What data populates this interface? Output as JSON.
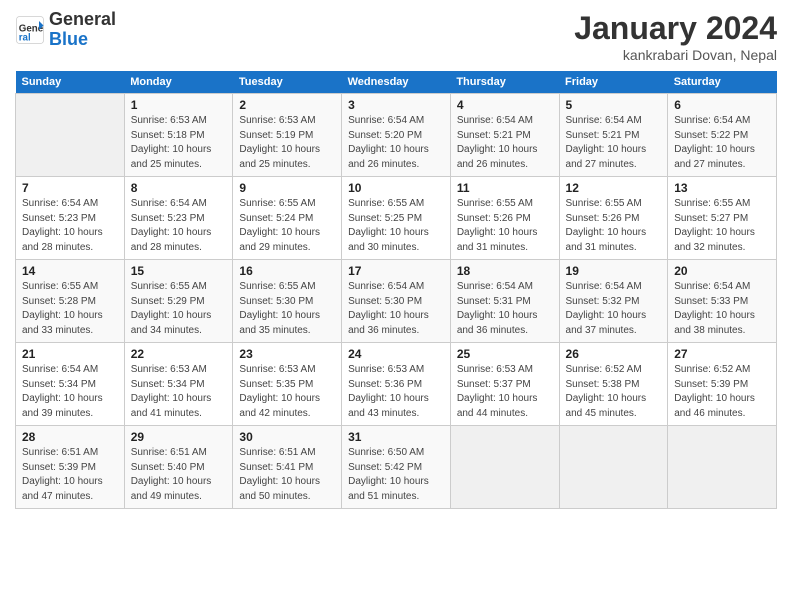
{
  "header": {
    "logo_line1": "General",
    "logo_line2": "Blue",
    "month": "January 2024",
    "location": "kankrabari Dovan, Nepal"
  },
  "weekdays": [
    "Sunday",
    "Monday",
    "Tuesday",
    "Wednesday",
    "Thursday",
    "Friday",
    "Saturday"
  ],
  "weeks": [
    [
      {
        "num": "",
        "info": ""
      },
      {
        "num": "1",
        "info": "Sunrise: 6:53 AM\nSunset: 5:18 PM\nDaylight: 10 hours\nand 25 minutes."
      },
      {
        "num": "2",
        "info": "Sunrise: 6:53 AM\nSunset: 5:19 PM\nDaylight: 10 hours\nand 25 minutes."
      },
      {
        "num": "3",
        "info": "Sunrise: 6:54 AM\nSunset: 5:20 PM\nDaylight: 10 hours\nand 26 minutes."
      },
      {
        "num": "4",
        "info": "Sunrise: 6:54 AM\nSunset: 5:21 PM\nDaylight: 10 hours\nand 26 minutes."
      },
      {
        "num": "5",
        "info": "Sunrise: 6:54 AM\nSunset: 5:21 PM\nDaylight: 10 hours\nand 27 minutes."
      },
      {
        "num": "6",
        "info": "Sunrise: 6:54 AM\nSunset: 5:22 PM\nDaylight: 10 hours\nand 27 minutes."
      }
    ],
    [
      {
        "num": "7",
        "info": "Sunrise: 6:54 AM\nSunset: 5:23 PM\nDaylight: 10 hours\nand 28 minutes."
      },
      {
        "num": "8",
        "info": "Sunrise: 6:54 AM\nSunset: 5:23 PM\nDaylight: 10 hours\nand 28 minutes."
      },
      {
        "num": "9",
        "info": "Sunrise: 6:55 AM\nSunset: 5:24 PM\nDaylight: 10 hours\nand 29 minutes."
      },
      {
        "num": "10",
        "info": "Sunrise: 6:55 AM\nSunset: 5:25 PM\nDaylight: 10 hours\nand 30 minutes."
      },
      {
        "num": "11",
        "info": "Sunrise: 6:55 AM\nSunset: 5:26 PM\nDaylight: 10 hours\nand 31 minutes."
      },
      {
        "num": "12",
        "info": "Sunrise: 6:55 AM\nSunset: 5:26 PM\nDaylight: 10 hours\nand 31 minutes."
      },
      {
        "num": "13",
        "info": "Sunrise: 6:55 AM\nSunset: 5:27 PM\nDaylight: 10 hours\nand 32 minutes."
      }
    ],
    [
      {
        "num": "14",
        "info": "Sunrise: 6:55 AM\nSunset: 5:28 PM\nDaylight: 10 hours\nand 33 minutes."
      },
      {
        "num": "15",
        "info": "Sunrise: 6:55 AM\nSunset: 5:29 PM\nDaylight: 10 hours\nand 34 minutes."
      },
      {
        "num": "16",
        "info": "Sunrise: 6:55 AM\nSunset: 5:30 PM\nDaylight: 10 hours\nand 35 minutes."
      },
      {
        "num": "17",
        "info": "Sunrise: 6:54 AM\nSunset: 5:30 PM\nDaylight: 10 hours\nand 36 minutes."
      },
      {
        "num": "18",
        "info": "Sunrise: 6:54 AM\nSunset: 5:31 PM\nDaylight: 10 hours\nand 36 minutes."
      },
      {
        "num": "19",
        "info": "Sunrise: 6:54 AM\nSunset: 5:32 PM\nDaylight: 10 hours\nand 37 minutes."
      },
      {
        "num": "20",
        "info": "Sunrise: 6:54 AM\nSunset: 5:33 PM\nDaylight: 10 hours\nand 38 minutes."
      }
    ],
    [
      {
        "num": "21",
        "info": "Sunrise: 6:54 AM\nSunset: 5:34 PM\nDaylight: 10 hours\nand 39 minutes."
      },
      {
        "num": "22",
        "info": "Sunrise: 6:53 AM\nSunset: 5:34 PM\nDaylight: 10 hours\nand 41 minutes."
      },
      {
        "num": "23",
        "info": "Sunrise: 6:53 AM\nSunset: 5:35 PM\nDaylight: 10 hours\nand 42 minutes."
      },
      {
        "num": "24",
        "info": "Sunrise: 6:53 AM\nSunset: 5:36 PM\nDaylight: 10 hours\nand 43 minutes."
      },
      {
        "num": "25",
        "info": "Sunrise: 6:53 AM\nSunset: 5:37 PM\nDaylight: 10 hours\nand 44 minutes."
      },
      {
        "num": "26",
        "info": "Sunrise: 6:52 AM\nSunset: 5:38 PM\nDaylight: 10 hours\nand 45 minutes."
      },
      {
        "num": "27",
        "info": "Sunrise: 6:52 AM\nSunset: 5:39 PM\nDaylight: 10 hours\nand 46 minutes."
      }
    ],
    [
      {
        "num": "28",
        "info": "Sunrise: 6:51 AM\nSunset: 5:39 PM\nDaylight: 10 hours\nand 47 minutes."
      },
      {
        "num": "29",
        "info": "Sunrise: 6:51 AM\nSunset: 5:40 PM\nDaylight: 10 hours\nand 49 minutes."
      },
      {
        "num": "30",
        "info": "Sunrise: 6:51 AM\nSunset: 5:41 PM\nDaylight: 10 hours\nand 50 minutes."
      },
      {
        "num": "31",
        "info": "Sunrise: 6:50 AM\nSunset: 5:42 PM\nDaylight: 10 hours\nand 51 minutes."
      },
      {
        "num": "",
        "info": ""
      },
      {
        "num": "",
        "info": ""
      },
      {
        "num": "",
        "info": ""
      }
    ]
  ]
}
